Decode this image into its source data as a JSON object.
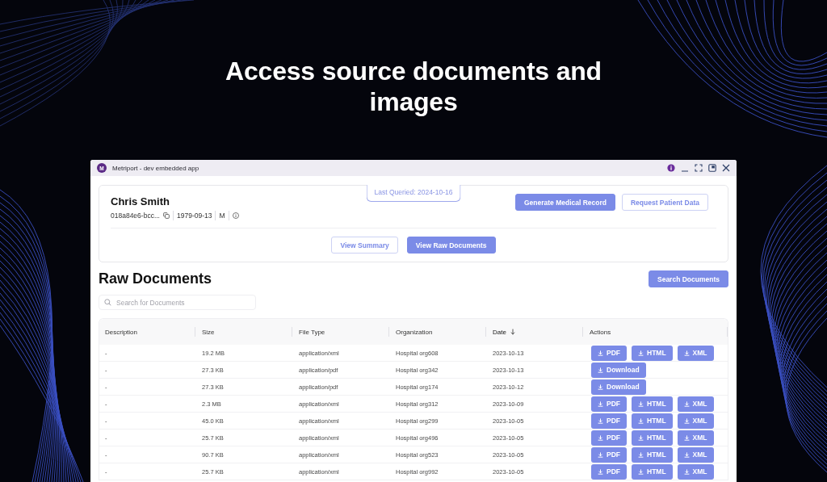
{
  "headline": "Access source documents and images",
  "window": {
    "title": "Metriport - dev embedded app",
    "app_badge": "M"
  },
  "patient": {
    "last_queried": "Last Queried: 2024-10-16",
    "name": "Chris Smith",
    "id": "018a84e6-bcc...",
    "birth_date": "1979-09-13",
    "gender": "M",
    "actions": [
      {
        "label": "Generate Medical Record",
        "kind": "primary"
      },
      {
        "label": "Request Patient Data",
        "kind": "outline"
      }
    ],
    "views": [
      {
        "label": "View Summary",
        "selected": false
      },
      {
        "label": "View Raw Documents",
        "selected": true
      }
    ]
  },
  "documents": {
    "title": "Raw Documents",
    "search_button": "Search Documents",
    "search": {
      "placeholder": "Search for Documents"
    },
    "table": {
      "columns": [
        {
          "label": "Description",
          "sorted": false
        },
        {
          "label": "Size",
          "sorted": false
        },
        {
          "label": "File Type",
          "sorted": false
        },
        {
          "label": "Organization",
          "sorted": false
        },
        {
          "label": "Date",
          "sorted": true
        },
        {
          "label": "Actions",
          "sorted": false
        }
      ],
      "rows": [
        {
          "description": "-",
          "size": "19.2 MB",
          "file_type": "application/xml",
          "organization": "Hospital org608",
          "date": "2023-10-13",
          "actions": [
            "PDF",
            "HTML",
            "XML"
          ]
        },
        {
          "description": "-",
          "size": "27.3 KB",
          "file_type": "application/pdf",
          "organization": "Hospital org342",
          "date": "2023-10-13",
          "actions": [
            "Download"
          ]
        },
        {
          "description": "-",
          "size": "27.3 KB",
          "file_type": "application/pdf",
          "organization": "Hospital org174",
          "date": "2023-10-12",
          "actions": [
            "Download"
          ]
        },
        {
          "description": "-",
          "size": "2.3 MB",
          "file_type": "application/xml",
          "organization": "Hospital org312",
          "date": "2023-10-09",
          "actions": [
            "PDF",
            "HTML",
            "XML"
          ]
        },
        {
          "description": "-",
          "size": "45.0 KB",
          "file_type": "application/xml",
          "organization": "Hospital org299",
          "date": "2023-10-05",
          "actions": [
            "PDF",
            "HTML",
            "XML"
          ]
        },
        {
          "description": "-",
          "size": "25.7 KB",
          "file_type": "application/xml",
          "organization": "Hospital org496",
          "date": "2023-10-05",
          "actions": [
            "PDF",
            "HTML",
            "XML"
          ]
        },
        {
          "description": "-",
          "size": "90.7 KB",
          "file_type": "application/xml",
          "organization": "Hospital org523",
          "date": "2023-10-05",
          "actions": [
            "PDF",
            "HTML",
            "XML"
          ]
        },
        {
          "description": "-",
          "size": "25.7 KB",
          "file_type": "application/xml",
          "organization": "Hospital org992",
          "date": "2023-10-05",
          "actions": [
            "PDF",
            "HTML",
            "XML"
          ]
        }
      ]
    }
  }
}
